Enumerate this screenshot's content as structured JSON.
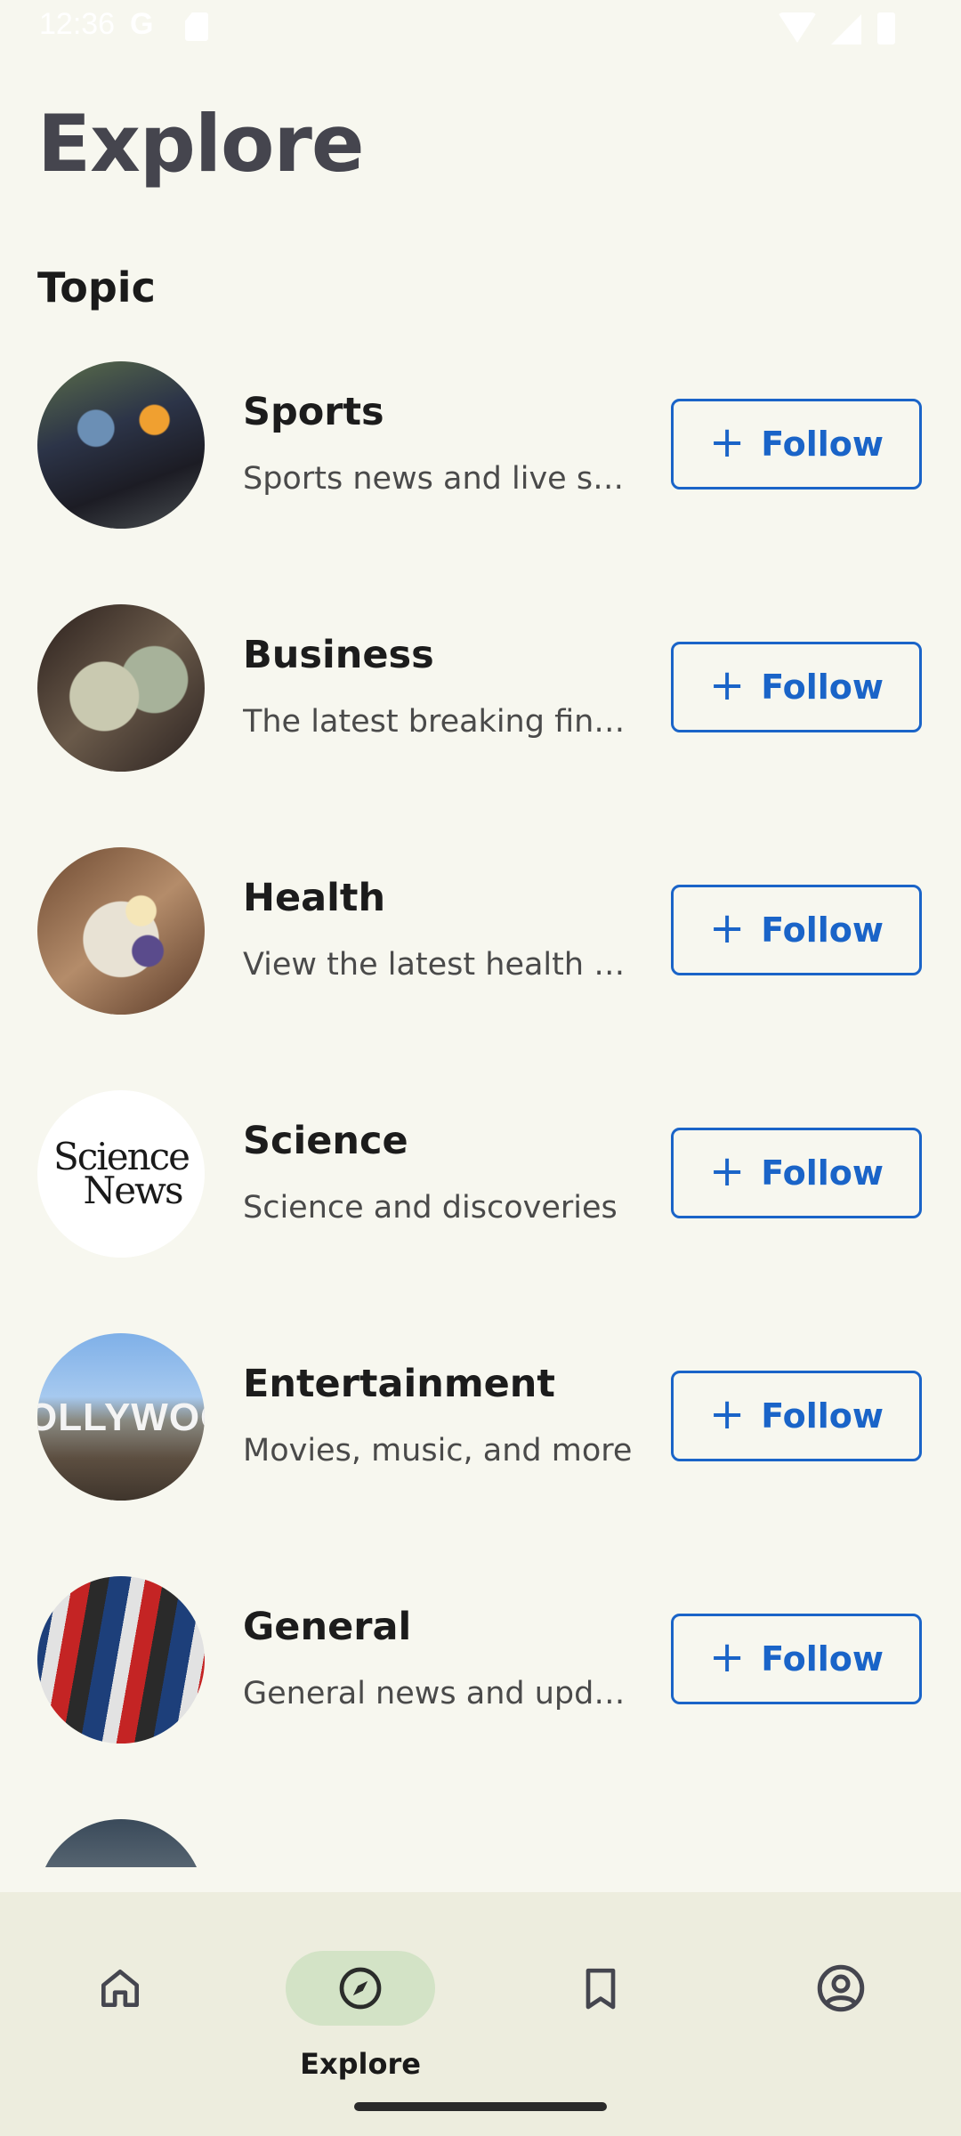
{
  "status_bar": {
    "time": "12:36",
    "carrier_icon": "G"
  },
  "page": {
    "title": "Explore",
    "section_title": "Topic"
  },
  "follow_label": "Follow",
  "topics": [
    {
      "name": "Sports",
      "description": "Sports news and live sports coverage",
      "image": "cyclists-photo"
    },
    {
      "name": "Business",
      "description": "The latest breaking financial news",
      "image": "money-hands-photo"
    },
    {
      "name": "Health",
      "description": "View the latest health news",
      "image": "food-bowl-photo"
    },
    {
      "name": "Science",
      "description": "Science and discoveries",
      "image": "science-news-logo",
      "logo_text": [
        "Science",
        "News"
      ]
    },
    {
      "name": "Entertainment",
      "description": "Movies, music, and more",
      "image": "hollywood-sign-photo",
      "image_text": "OLLYWOO"
    },
    {
      "name": "General",
      "description": "General news and updates",
      "image": "magazine-rack-photo"
    }
  ],
  "bottom_nav": {
    "items": [
      {
        "icon": "home-icon",
        "selected": false
      },
      {
        "icon": "compass-icon",
        "label": "Explore",
        "selected": true
      },
      {
        "icon": "bookmark-icon",
        "selected": false
      },
      {
        "icon": "account-circle-icon",
        "selected": false
      }
    ]
  },
  "colors": {
    "background": "#f7f7ef",
    "accent": "#1a64c8",
    "nav_background": "#ededde",
    "nav_pill": "#d3e3c6",
    "title": "#45454e"
  }
}
